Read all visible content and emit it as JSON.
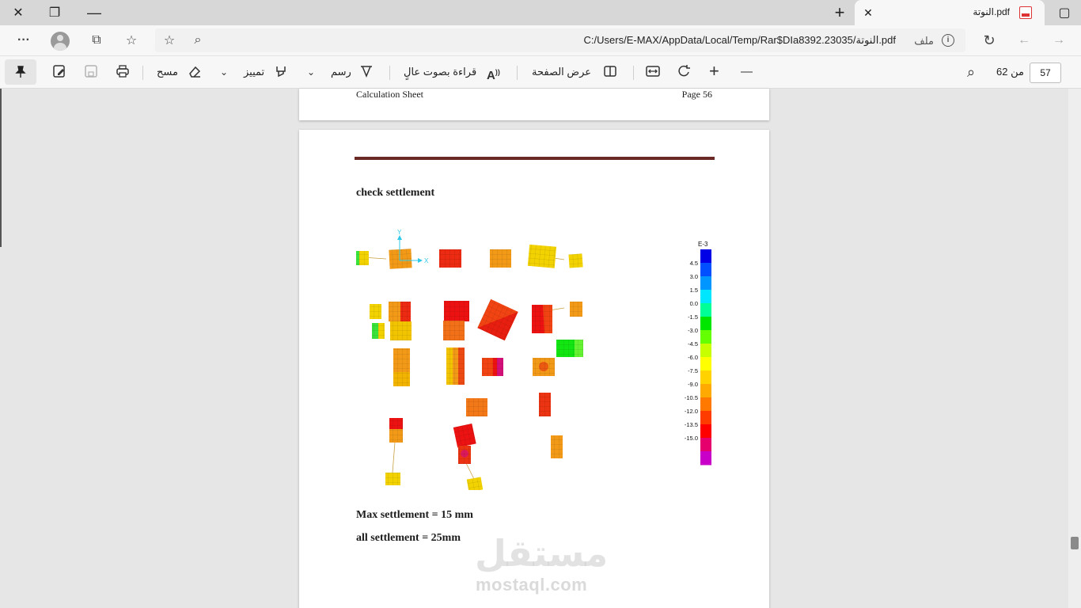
{
  "window": {
    "tab_title": "النوتة.pdf",
    "close_glyph": "✕",
    "new_tab_glyph": "+",
    "restore_glyph": "❐",
    "tab_close_glyph": "✕",
    "tab_actions_glyph": "▢"
  },
  "address_bar": {
    "url": "C:/Users/E-MAX/AppData/Local/Temp/Rar$DIa8392.23035/النوتة.pdf",
    "file_label": "ملف",
    "info_glyph": "i",
    "menu_glyph": "···",
    "back_glyph": "←",
    "forward_glyph": "→",
    "refresh_glyph": "↻",
    "favorites_glyph": "☆",
    "collections_glyph": "⧉",
    "zoom_glyph": "⌕"
  },
  "pdf_toolbar": {
    "pin_glyph": "📌",
    "erase_label": "مسح",
    "highlight_label": "تمييز",
    "draw_label": "رسم",
    "read_aloud_label": "قراءة بصوت عالٍ",
    "page_view_label": "عرض الصفحة",
    "page_of_label": "من 62",
    "current_page": "57",
    "plus_glyph": "+",
    "minus_glyph": "—",
    "search_glyph": "⌕",
    "chevron_glyph": "⌄"
  },
  "document": {
    "prev_page_footer_left": "Calculation Sheet",
    "prev_page_footer_right": "Page 56",
    "heading": "check settlement",
    "max_settlement": "Max settlement = 15 mm",
    "all_settlement": "all settlement = 25mm"
  },
  "legend": {
    "exponent": "E-3",
    "ticks": [
      "4.5",
      "3.0",
      "1.5",
      "0.0",
      "-1.5",
      "-3.0",
      "-4.5",
      "-6.0",
      "-7.5",
      "-9.0",
      "-10.5",
      "-12.0",
      "-13.5",
      "-15.0"
    ],
    "colors": [
      "#0000e6",
      "#0050ff",
      "#0096ff",
      "#00e6ff",
      "#00ff96",
      "#00e600",
      "#64ff00",
      "#c8ff00",
      "#ffff00",
      "#ffd200",
      "#ffaa00",
      "#ff7800",
      "#ff3c00",
      "#ff0000",
      "#e6006e",
      "#c800c8"
    ]
  },
  "axes_marker": {
    "x": "X",
    "y": "Y"
  },
  "watermark": {
    "arabic": "مستقل",
    "latin": "mostaql.com"
  },
  "colors": {
    "rule": "#6b2a26",
    "footing_yellow": "#f2d200",
    "footing_orange": "#f29a18",
    "footing_red": "#ec2b12",
    "footing_green": "#3ae23a"
  }
}
